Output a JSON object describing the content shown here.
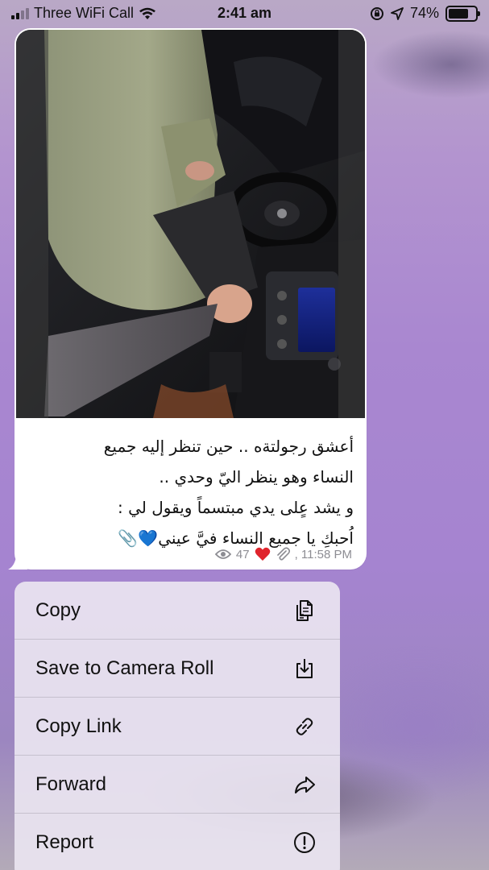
{
  "status_bar": {
    "carrier": "Three WiFi Call",
    "time": "2:41 am",
    "battery_percent": "74%",
    "battery_level": 0.74
  },
  "message": {
    "caption_lines": [
      "أعشق رجولتةه .. حين تنظر إليه جميع",
      "النساء وهو ينظر اليّ وحدي ..",
      "و يشد عٍلى يدي مبتسماً ويقول لي :",
      "اُحبكِ يا جميع النساء فيَّ عيني💙📎"
    ],
    "views": "47",
    "reaction_icon": "heart-icon",
    "time": ", 11:58 PM"
  },
  "context_menu": {
    "items": [
      {
        "label": "Copy",
        "icon": "copy-icon"
      },
      {
        "label": "Save to Camera Roll",
        "icon": "save-download-icon"
      },
      {
        "label": "Copy Link",
        "icon": "link-icon"
      },
      {
        "label": "Forward",
        "icon": "forward-icon"
      },
      {
        "label": "Report",
        "icon": "exclamation-circle-icon"
      }
    ]
  },
  "colors": {
    "accent_red": "#e0242c",
    "meta_gray": "#8d8d93",
    "menu_bg": "#eae4f0"
  }
}
